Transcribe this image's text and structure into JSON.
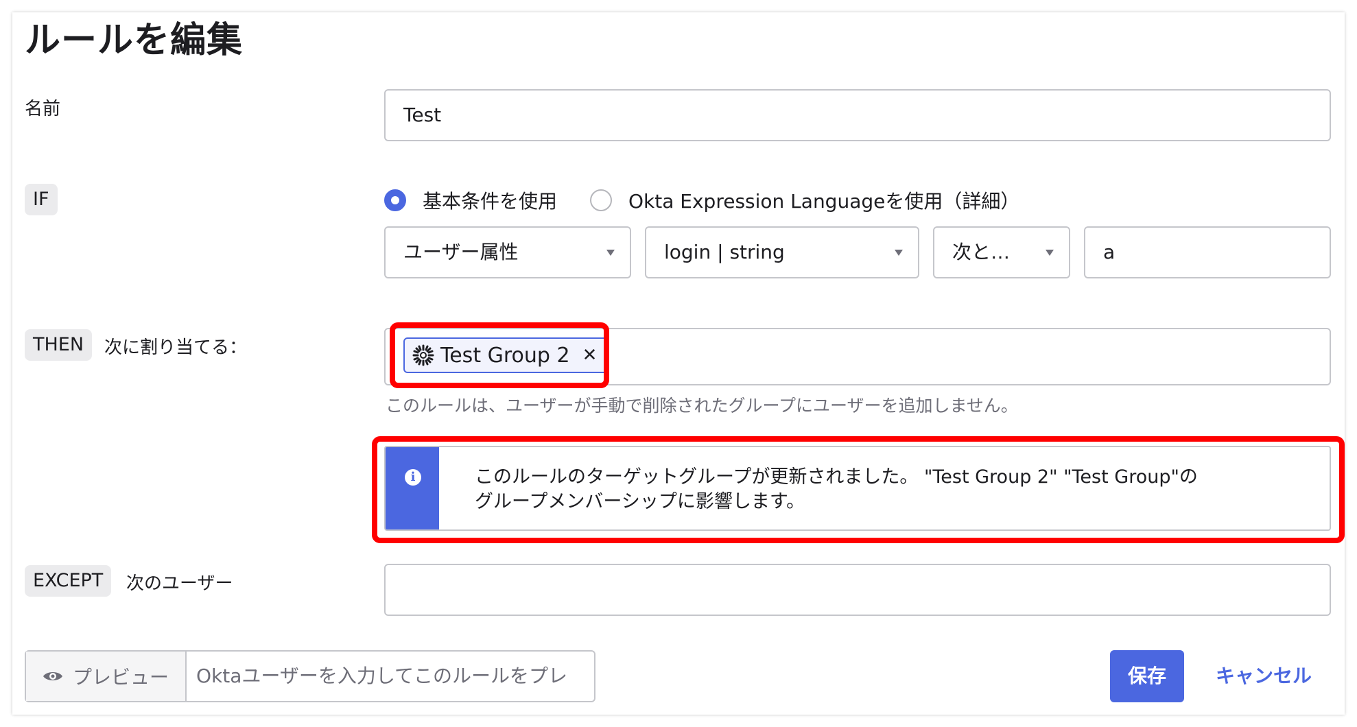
{
  "page": {
    "title": "ルールを編集"
  },
  "name_row": {
    "label": "名前",
    "value": "Test"
  },
  "if_row": {
    "tag": "IF",
    "radio_basic": "基本条件を使用",
    "radio_expression": "Okta Expression Languageを使用（詳細）",
    "selected": "basic",
    "attribute_select": "ユーザー属性",
    "field_select": "login | string",
    "operator_select": "次と…",
    "value_input": "a"
  },
  "then_row": {
    "tag": "THEN",
    "label": "次に割り当てる：",
    "chips": [
      {
        "label": "Test Group 2",
        "icon": "okta-group-icon"
      }
    ],
    "hint": "このルールは、ユーザーが手動で削除されたグループにユーザーを追加しません。"
  },
  "callout": {
    "icon": "info-icon",
    "line1": "このルールのターゲットグループが更新されました。 \"Test Group 2\" \"Test Group\"の",
    "line2": "グループメンバーシップに影響します。"
  },
  "except_row": {
    "tag": "EXCEPT",
    "label": "次のユーザー",
    "value": ""
  },
  "footer": {
    "preview_label": "プレビュー",
    "preview_placeholder": "Oktaユーザーを入力してこのルールをプレ",
    "save_label": "保存",
    "cancel_label": "キャンセル"
  },
  "colors": {
    "accent": "#4b67e0",
    "highlight": "#ff0000",
    "border": "#c5c6cb",
    "muted_text": "#6e6e78"
  }
}
